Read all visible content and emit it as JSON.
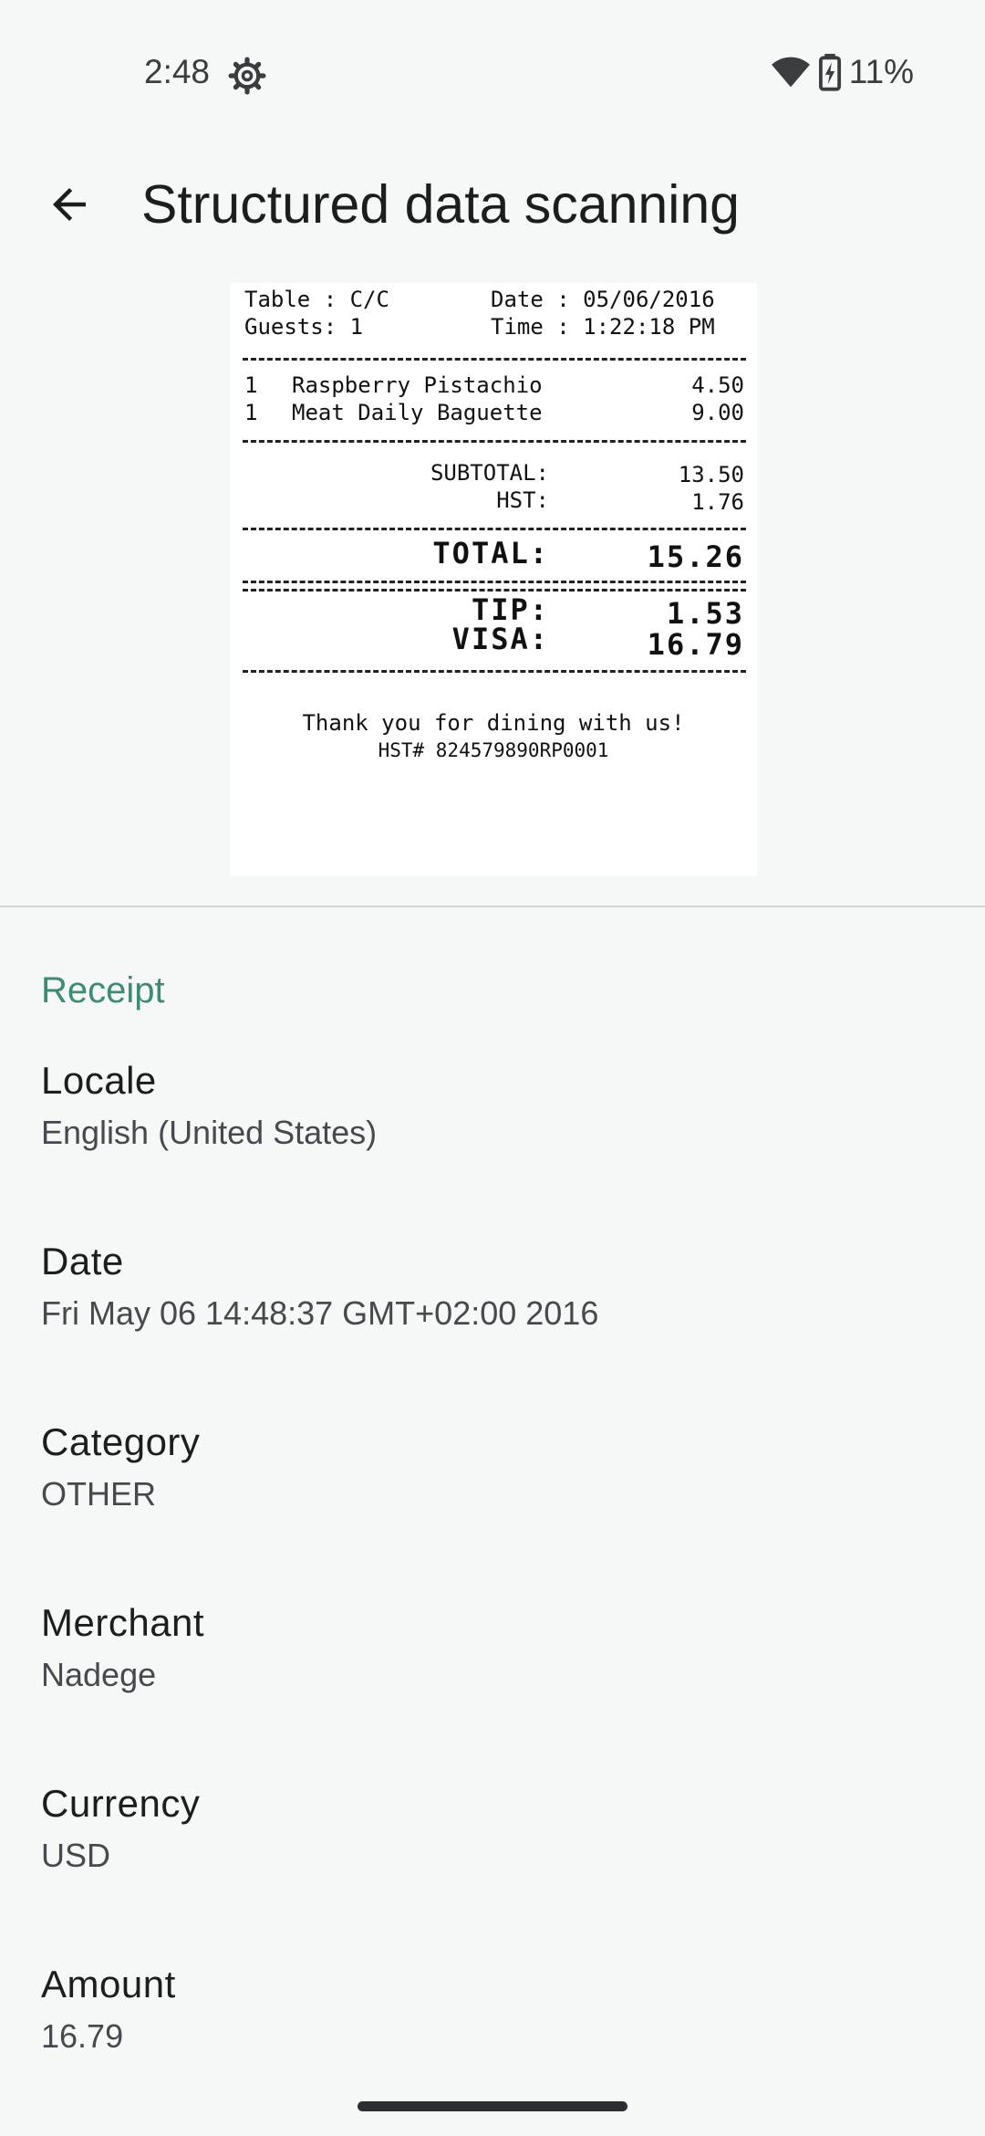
{
  "status_bar": {
    "time": "2:48",
    "battery": "11%",
    "icons": [
      "gear-icon",
      "wifi-icon",
      "battery-charging-icon"
    ]
  },
  "app_bar": {
    "title": "Structured data scanning",
    "back_icon": "arrow-back-icon"
  },
  "receipt": {
    "table": "Table : C/C",
    "guests": "Guests: 1",
    "date": "Date : 05/06/2016",
    "time": "Time : 1:22:18 PM",
    "items": [
      {
        "qty": "1",
        "name": "Raspberry Pistachio",
        "price": "4.50"
      },
      {
        "qty": "1",
        "name": "Meat Daily Baguette",
        "price": "9.00"
      }
    ],
    "subtotal_label": "SUBTOTAL:",
    "subtotal": "13.50",
    "hst_label": "HST:",
    "hst": "1.76",
    "total_label": "TOTAL:",
    "total": "15.26",
    "tip_label": "TIP:",
    "tip": "1.53",
    "visa_label": "VISA:",
    "visa": "16.79",
    "thanks": "Thank you for dining with us!",
    "hst_number": "HST# 824579890RP0001"
  },
  "section": {
    "title": "Receipt"
  },
  "fields": [
    {
      "label": "Locale",
      "value": "English (United States)"
    },
    {
      "label": "Date",
      "value": "Fri May 06 14:48:37 GMT+02:00 2016"
    },
    {
      "label": "Category",
      "value": "OTHER"
    },
    {
      "label": "Merchant",
      "value": "Nadege"
    },
    {
      "label": "Currency",
      "value": "USD"
    },
    {
      "label": "Amount",
      "value": "16.79"
    }
  ],
  "colors": {
    "background": "#f6f8f8",
    "accent": "#3d8a76"
  }
}
